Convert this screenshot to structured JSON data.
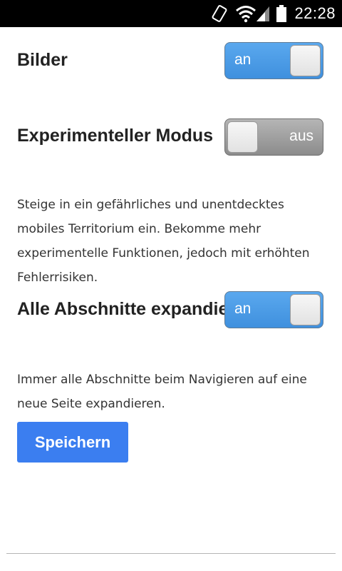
{
  "status_bar": {
    "time": "22:28",
    "icons": [
      "rotation-lock-icon",
      "wifi-icon",
      "signal-icon",
      "battery-icon"
    ]
  },
  "settings": {
    "images": {
      "label": "Bilder",
      "toggle_state": "an"
    },
    "experimental": {
      "label": "Experimenteller Modus",
      "toggle_state": "aus",
      "description": "Steige in ein gefährliches und unentdecktes mobiles Territorium ein. Bekomme mehr experimentelle Funktionen, jedoch mit erhöhten Fehlerrisiken."
    },
    "expand_sections": {
      "label": "Alle Abschnitte expandieren",
      "toggle_state": "an",
      "description": "Immer alle Abschnitte beim Navigieren auf eine neue Seite expandieren."
    }
  },
  "save_button": {
    "label": "Speichern"
  },
  "colors": {
    "toggle_on": "#4a9be6",
    "toggle_off": "#9e9e9e",
    "button": "#3b7ef0",
    "status_bar": "#000000"
  }
}
